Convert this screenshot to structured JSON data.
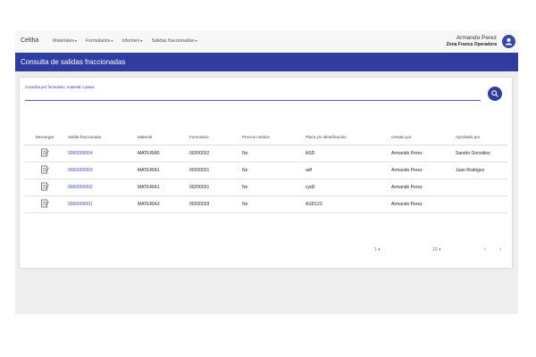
{
  "app": {
    "brand": "Celtha",
    "nav": [
      "Materiales",
      "Formularios",
      "Informes",
      "Salidas fraccionadas"
    ]
  },
  "user": {
    "name": "Armando Perez",
    "org": "Zona Franca Operadora"
  },
  "page": {
    "title": "Consulta de salidas fraccionadas"
  },
  "search": {
    "label": "Consulta por formulario, material o placa",
    "value": ""
  },
  "table": {
    "headers": [
      "Descargar",
      "Salida fraccionada",
      "Material",
      "Formulario",
      "Precios medios",
      "Placa y/o identificación",
      "Creado por",
      "Aprobado por"
    ],
    "rows": [
      [
        "",
        "0000000004",
        "MATERIA5",
        "00200032",
        "No",
        "ASD",
        "Armando Perez",
        "Sandro González"
      ],
      [
        "",
        "0000000003",
        "MATERIA1",
        "00200031",
        "No",
        "adf",
        "Armando Perez",
        "Juan Rodrigez"
      ],
      [
        "",
        "0000000002",
        "MATERIA1",
        "00200031",
        "No",
        "cyd2",
        "Armando Perez",
        ""
      ],
      [
        "",
        "0000000001",
        "MATERIA3",
        "00200039",
        "No",
        "ASD123",
        "Armando Perez",
        ""
      ]
    ]
  },
  "pager": {
    "page": "1",
    "page_size": "10",
    "prev": "‹",
    "next": "›"
  },
  "colors": {
    "primary": "#2f3ca0",
    "link": "#3a4fc0"
  }
}
